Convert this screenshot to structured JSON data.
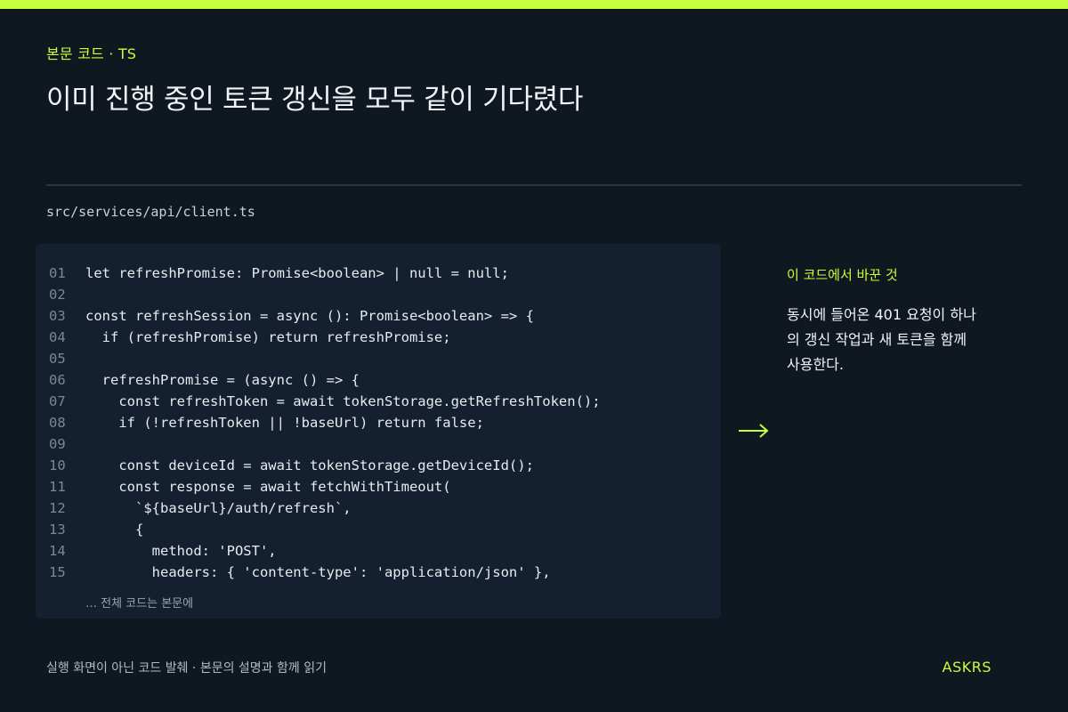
{
  "colors": {
    "background": "#0f1720",
    "accent": "#c6ff3d",
    "code_panel": "#142030",
    "divider": "#2c343c"
  },
  "header": {
    "eyebrow": "본문 코드 · TS",
    "title": "이미 진행 중인 토큰 갱신을 모두 같이 기다렸다"
  },
  "file": {
    "path": "src/services/api/client.ts"
  },
  "code": {
    "lines": [
      {
        "no": "01",
        "text": "let refreshPromise: Promise<boolean> | null = null;"
      },
      {
        "no": "02",
        "text": ""
      },
      {
        "no": "03",
        "text": "const refreshSession = async (): Promise<boolean> => {"
      },
      {
        "no": "04",
        "text": "  if (refreshPromise) return refreshPromise;"
      },
      {
        "no": "05",
        "text": ""
      },
      {
        "no": "06",
        "text": "  refreshPromise = (async () => {"
      },
      {
        "no": "07",
        "text": "    const refreshToken = await tokenStorage.getRefreshToken();"
      },
      {
        "no": "08",
        "text": "    if (!refreshToken || !baseUrl) return false;"
      },
      {
        "no": "09",
        "text": ""
      },
      {
        "no": "10",
        "text": "    const deviceId = await tokenStorage.getDeviceId();"
      },
      {
        "no": "11",
        "text": "    const response = await fetchWithTimeout("
      },
      {
        "no": "12",
        "text": "      `${baseUrl}/auth/refresh`,"
      },
      {
        "no": "13",
        "text": "      {"
      },
      {
        "no": "14",
        "text": "        method: 'POST',"
      },
      {
        "no": "15",
        "text": "        headers: { 'content-type': 'application/json' },"
      }
    ],
    "footer": "… 전체 코드는 본문에"
  },
  "side": {
    "arrow_icon": "arrow-right-icon",
    "label": "이 코드에서 바꾼 것",
    "body": "동시에 들어온 401 요청이 하나의 갱신 작업과 새 토큰을 함께 사용한다."
  },
  "footer": {
    "note": "실행 화면이 아닌 코드 발췌 · 본문의 설명과 함께 읽기",
    "brand": "ASKRS"
  }
}
